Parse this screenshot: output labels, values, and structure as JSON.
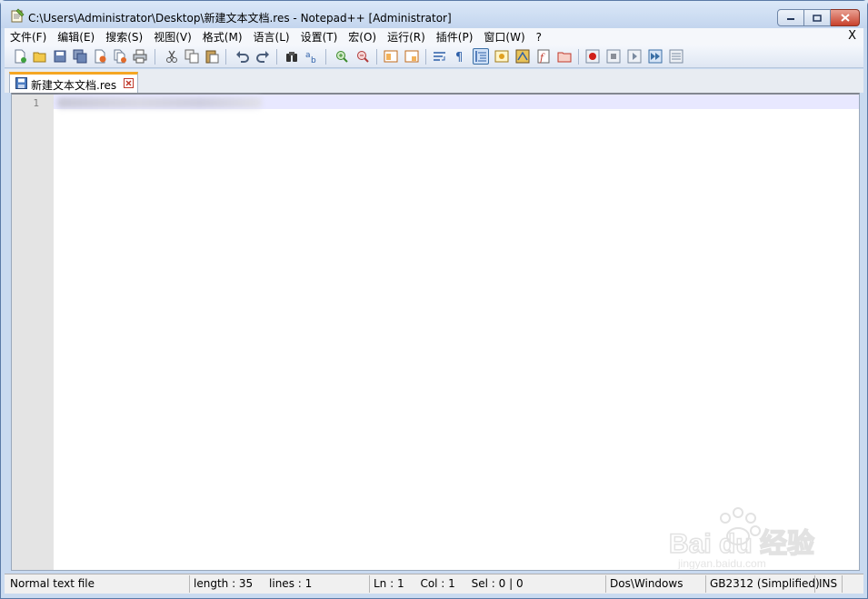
{
  "window": {
    "title": "C:\\Users\\Administrator\\Desktop\\新建文本文档.res - Notepad++ [Administrator]"
  },
  "menu": {
    "items": [
      {
        "label": "文件(F)"
      },
      {
        "label": "编辑(E)"
      },
      {
        "label": "搜索(S)"
      },
      {
        "label": "视图(V)"
      },
      {
        "label": "格式(M)"
      },
      {
        "label": "语言(L)"
      },
      {
        "label": "设置(T)"
      },
      {
        "label": "宏(O)"
      },
      {
        "label": "运行(R)"
      },
      {
        "label": "插件(P)"
      },
      {
        "label": "窗口(W)"
      },
      {
        "label": "?"
      }
    ],
    "close_label": "X"
  },
  "toolbar": {
    "buttons": [
      "new-icon",
      "open-icon",
      "save-icon",
      "save-all-icon",
      "close-icon",
      "close-all-icon",
      "print-icon",
      "cut-icon",
      "copy-icon",
      "paste-icon",
      "undo-icon",
      "redo-icon",
      "find-icon",
      "replace-icon",
      "zoom-in-icon",
      "zoom-out-icon",
      "sync-vertical-icon",
      "sync-horizontal-icon",
      "word-wrap-icon",
      "show-all-chars-icon",
      "indent-guide-icon",
      "user-define-icon",
      "doc-map-icon",
      "function-list-icon",
      "folder-as-workspace-icon",
      "record-macro-icon",
      "stop-record-icon",
      "play-macro-icon",
      "run-macro-multiple-icon",
      "save-macro-icon"
    ]
  },
  "tab": {
    "label": "新建文本文档.res"
  },
  "editor": {
    "line_number": "1"
  },
  "status": {
    "file_type": "Normal text file",
    "length": "length : 35",
    "lines": "lines : 1",
    "ln": "Ln : 1",
    "col": "Col : 1",
    "sel": "Sel : 0 | 0",
    "eol": "Dos\\Windows",
    "encoding": "GB2312 (Simplified)",
    "mode": "INS"
  },
  "watermark": {
    "text": "Bai du 经验",
    "url": "jingyan.baidu.com"
  },
  "colors": {
    "title_bg": "#c3d5ee",
    "tab_accent": "#f5a623",
    "current_line": "#e8e8ff",
    "gutter": "#e4e4e4"
  }
}
